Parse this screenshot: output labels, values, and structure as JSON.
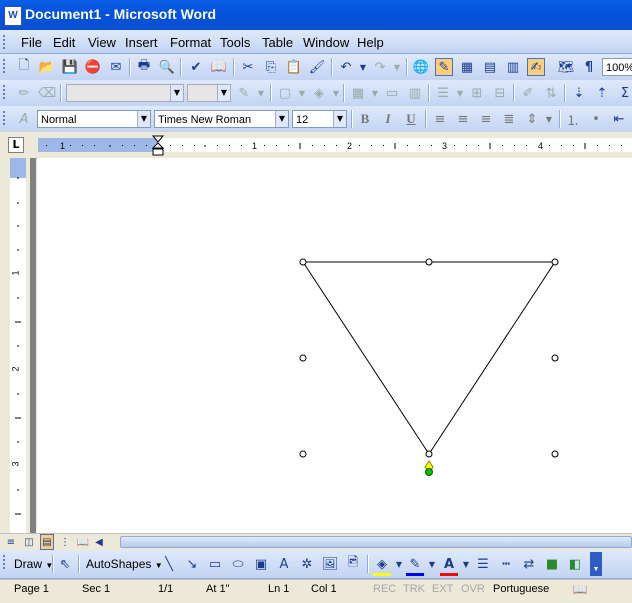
{
  "window": {
    "title": "Document1 - Microsoft Word",
    "app_icon": "W"
  },
  "menubar": {
    "items": [
      "File",
      "Edit",
      "View",
      "Insert",
      "Format",
      "Tools",
      "Table",
      "Window",
      "Help"
    ]
  },
  "standard_toolbar": {
    "zoom": "100%"
  },
  "formatting_toolbar": {
    "style": "Normal",
    "font": "Times New Roman",
    "size": "12",
    "bold": "B",
    "italic": "I",
    "underline": "U"
  },
  "ruler": {
    "marks": [
      "1",
      "1",
      "2",
      "3",
      "4"
    ]
  },
  "vruler": {
    "marks": [
      "1",
      "2",
      "3"
    ]
  },
  "drawing_toolbar": {
    "draw_label": "Draw",
    "autoshapes_label": "AutoShapes"
  },
  "status_bar": {
    "page": "Page 1",
    "sec": "Sec 1",
    "pages": "1/1",
    "at": "At 1\"",
    "ln": "Ln 1",
    "col": "Col 1",
    "rec": "REC",
    "trk": "TRK",
    "ext": "EXT",
    "ovr": "OVR",
    "language": "Portuguese"
  },
  "colors": {
    "title_bar": "#0a5ee8",
    "toolbar": "#c3d4f2",
    "page": "#ffffff",
    "handle_yellow": "#ffff00",
    "handle_green": "#00c000"
  }
}
